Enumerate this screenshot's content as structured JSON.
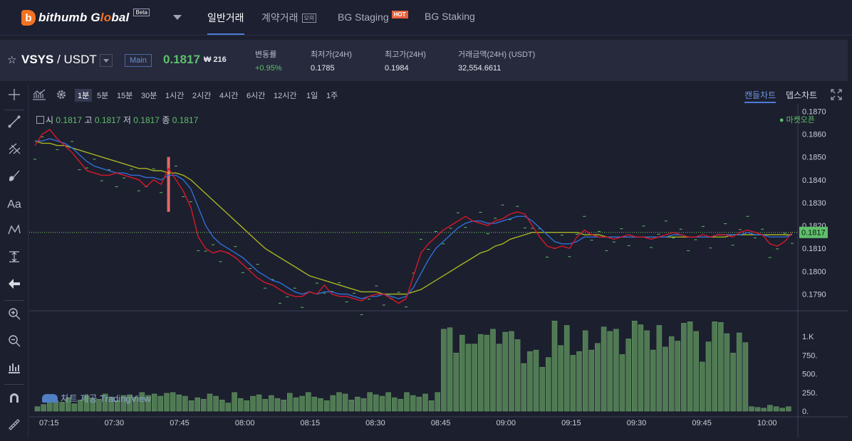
{
  "nav": {
    "logo_mark": "b",
    "logo_text_a": "bithumb G",
    "logo_text_b": "lo",
    "logo_text_c": "bal",
    "beta": "Beta",
    "items": [
      {
        "label": "일반거래"
      },
      {
        "label": "계약거래",
        "tag": "모의"
      },
      {
        "label": "BG Staging",
        "tag": "HOT"
      },
      {
        "label": "BG Staking"
      }
    ]
  },
  "ticker": {
    "base": "VSYS",
    "sep": " / ",
    "quote": "USDT",
    "badge": "Main",
    "price": "0.1817",
    "krw": "₩ 216",
    "stats": [
      {
        "label": "변동률",
        "value": "+0.95%"
      },
      {
        "label": "최저가(24H)",
        "value": "0.1785"
      },
      {
        "label": "최고가(24H)",
        "value": "0.1984"
      },
      {
        "label": "거래금액(24H) (USDT)",
        "value": "32,554.6611"
      }
    ]
  },
  "toolbar": {
    "intervals": [
      "1분",
      "5분",
      "15분",
      "30분",
      "1시간",
      "2시간",
      "4시간",
      "6시간",
      "12시간",
      "1일",
      "1주"
    ],
    "active_interval": "1분",
    "views": [
      "캔들차트",
      "뎁스차트"
    ]
  },
  "legend": {
    "open_label": "시",
    "open": "0.1817",
    "high_label": "고",
    "high": "0.1817",
    "low_label": "저",
    "low": "0.1817",
    "close_label": "종",
    "close": "0.1817"
  },
  "market_status": "● 마켓오픈",
  "watermark": "차트 제공 TradingView",
  "colors": {
    "up": "#5fbf6b",
    "accent": "#4d7bd8",
    "ma_fast": "#d8182a",
    "ma_mid": "#2f6fd6",
    "ma_slow": "#a6b422",
    "hot": "#e8603c"
  },
  "chart_data": {
    "type": "line",
    "price_axis_ticks": [
      "0.1870",
      "0.1860",
      "0.1850",
      "0.1840",
      "0.1830",
      "0.1820",
      "0.1810",
      "0.1800",
      "0.1790"
    ],
    "last_price_label": "0.1817",
    "volume_axis_ticks": [
      "1.K",
      "750.",
      "500.",
      "250.",
      "0."
    ],
    "time_ticks": [
      "07:15",
      "07:30",
      "07:45",
      "08:00",
      "08:15",
      "08:30",
      "08:45",
      "09:00",
      "09:15",
      "09:30",
      "09:45",
      "10:00"
    ],
    "ylim": [
      0.1783,
      0.1872
    ],
    "x_minutes": [
      0,
      102
    ],
    "series": [
      {
        "values": [
          0.1855,
          0.186,
          0.1862,
          0.1858,
          0.1855,
          0.1852,
          0.1848,
          0.1844,
          0.1843,
          0.1842,
          0.1842,
          0.1843,
          0.1842,
          0.1841,
          0.184,
          0.1837,
          0.184,
          0.1838,
          0.1845,
          0.184,
          0.1835,
          0.1828,
          0.1815,
          0.181,
          0.1808,
          0.1809,
          0.1808,
          0.1806,
          0.1803,
          0.18,
          0.1797,
          0.1795,
          0.1794,
          0.1792,
          0.179,
          0.1789,
          0.1789,
          0.1791,
          0.179,
          0.1794,
          0.179,
          0.1789,
          0.1789,
          0.1788,
          0.1787,
          0.1789,
          0.179,
          0.179,
          0.1788,
          0.1786,
          0.1788,
          0.1798,
          0.1808,
          0.1812,
          0.1815,
          0.1818,
          0.182,
          0.1822,
          0.1824,
          0.1822,
          0.1821,
          0.182,
          0.1822,
          0.1823,
          0.1825,
          0.1826,
          0.1825,
          0.182,
          0.1815,
          0.1811,
          0.181,
          0.1811,
          0.181,
          0.1815,
          0.1818,
          0.1816,
          0.1815,
          0.1815,
          0.1814,
          0.1815,
          0.1816,
          0.1815,
          0.1815,
          0.1814,
          0.1815,
          0.1816,
          0.1817,
          0.1816,
          0.1815,
          0.1815,
          0.1816,
          0.1815,
          0.1816,
          0.1816,
          0.1815,
          0.1817,
          0.1818,
          0.1817,
          0.1816,
          0.1812,
          0.1811,
          0.1813,
          0.1817
        ]
      },
      {
        "values": [
          0.1857,
          0.1857,
          0.1858,
          0.1857,
          0.1856,
          0.1854,
          0.1851,
          0.1848,
          0.1846,
          0.1845,
          0.1844,
          0.1843,
          0.1843,
          0.1842,
          0.1842,
          0.1841,
          0.1841,
          0.184,
          0.1842,
          0.1842,
          0.184,
          0.1836,
          0.1828,
          0.182,
          0.1815,
          0.1812,
          0.181,
          0.1808,
          0.1806,
          0.1803,
          0.18,
          0.1798,
          0.1796,
          0.1795,
          0.1793,
          0.1791,
          0.179,
          0.1791,
          0.179,
          0.1791,
          0.1791,
          0.179,
          0.179,
          0.1789,
          0.1788,
          0.1789,
          0.1789,
          0.179,
          0.1789,
          0.1788,
          0.1789,
          0.1793,
          0.1799,
          0.1805,
          0.181,
          0.1813,
          0.1816,
          0.1819,
          0.1821,
          0.1822,
          0.1822,
          0.1821,
          0.1821,
          0.1822,
          0.1823,
          0.1824,
          0.1824,
          0.1822,
          0.1819,
          0.1816,
          0.1813,
          0.1812,
          0.1812,
          0.1813,
          0.1815,
          0.1815,
          0.1815,
          0.1815,
          0.1815,
          0.1815,
          0.1815,
          0.1815,
          0.1815,
          0.1815,
          0.1815,
          0.1815,
          0.1816,
          0.1816,
          0.1815,
          0.1815,
          0.1815,
          0.1815,
          0.1816,
          0.1816,
          0.1816,
          0.1816,
          0.1817,
          0.1816,
          0.1816,
          0.1815,
          0.1815,
          0.1815,
          0.1816
        ]
      },
      {
        "values": [
          0.1857,
          0.1856,
          0.1856,
          0.1855,
          0.1855,
          0.1854,
          0.1853,
          0.1852,
          0.1851,
          0.185,
          0.1849,
          0.1848,
          0.1847,
          0.1846,
          0.1845,
          0.1845,
          0.1844,
          0.1844,
          0.1843,
          0.1843,
          0.1842,
          0.184,
          0.1837,
          0.1834,
          0.1831,
          0.1828,
          0.1825,
          0.1822,
          0.1819,
          0.1816,
          0.1813,
          0.181,
          0.1808,
          0.1806,
          0.1804,
          0.1802,
          0.18,
          0.1798,
          0.1797,
          0.1796,
          0.1795,
          0.1794,
          0.1793,
          0.1792,
          0.1791,
          0.1791,
          0.1791,
          0.179,
          0.179,
          0.179,
          0.179,
          0.1791,
          0.1792,
          0.1794,
          0.1796,
          0.1798,
          0.18,
          0.1802,
          0.1804,
          0.1806,
          0.1808,
          0.1809,
          0.1811,
          0.1812,
          0.1814,
          0.1815,
          0.1816,
          0.1817,
          0.1817,
          0.1817,
          0.1817,
          0.1817,
          0.1817,
          0.1817,
          0.1816,
          0.1816,
          0.1816,
          0.1815,
          0.1815,
          0.1815,
          0.1815,
          0.1815,
          0.1815,
          0.1815,
          0.1815,
          0.1815,
          0.1815,
          0.1815,
          0.1815,
          0.1815,
          0.1815,
          0.1815,
          0.1815,
          0.1815,
          0.1816,
          0.1816,
          0.1816,
          0.1816,
          0.1816,
          0.1816,
          0.1816,
          0.1816,
          0.1816
        ]
      }
    ],
    "volume": [
      60,
      90,
      110,
      140,
      120,
      180,
      100,
      150,
      210,
      170,
      160,
      230,
      190,
      140,
      210,
      220,
      190,
      250,
      210,
      230,
      200,
      240,
      250,
      220,
      200,
      140,
      180,
      160,
      230,
      200,
      150,
      110,
      250,
      170,
      140,
      200,
      220,
      160,
      210,
      170,
      150,
      240,
      180,
      200,
      250,
      190,
      170,
      140,
      210,
      250,
      230,
      150,
      190,
      170,
      250,
      220,
      200,
      250,
      180,
      160,
      250,
      210,
      190,
      230,
      140,
      250,
      1100,
      1120,
      780,
      1020,
      900,
      900,
      1030,
      1020,
      1100,
      900,
      1060,
      1070,
      960,
      640,
      800,
      820,
      590,
      720,
      1210,
      880,
      1150,
      750,
      800,
      1080,
      820,
      910,
      1130,
      1070,
      1100,
      760,
      970,
      1210,
      1160,
      1080,
      820,
      1150,
      860,
      1000,
      940,
      1180,
      1200,
      1070,
      660,
      930,
      1200,
      1190,
      1040,
      780,
      1050,
      920,
      60,
      50,
      40,
      80,
      60,
      40,
      60
    ]
  }
}
